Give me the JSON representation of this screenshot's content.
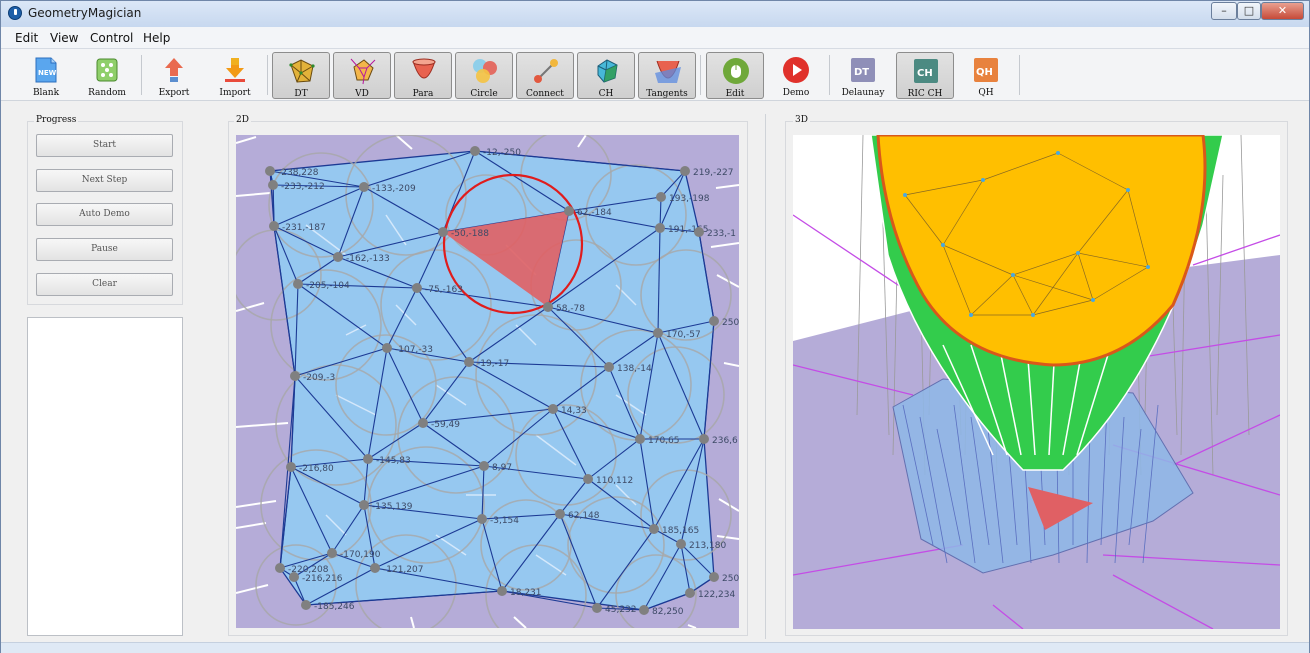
{
  "window": {
    "title": "GeometryMagician"
  },
  "window_controls": {
    "minimize": "–",
    "maximize": "□",
    "close": "✕"
  },
  "menu": [
    "Edit",
    "View",
    "Control",
    "Help"
  ],
  "toolbar": [
    {
      "label": "Blank",
      "icon": "new-file-icon",
      "active": false
    },
    {
      "label": "Random",
      "icon": "dice-icon",
      "active": false
    },
    {
      "label": "Export",
      "icon": "export-arrow-icon",
      "active": false
    },
    {
      "label": "Import",
      "icon": "import-arrow-icon",
      "active": false
    },
    {
      "label": "DT",
      "icon": "delaunay-icon",
      "active": true
    },
    {
      "label": "VD",
      "icon": "voronoi-icon",
      "active": true
    },
    {
      "label": "Para",
      "icon": "paraboloid-icon",
      "active": true
    },
    {
      "label": "Circle",
      "icon": "circles-icon",
      "active": true
    },
    {
      "label": "Connect",
      "icon": "connect-icon",
      "active": true
    },
    {
      "label": "CH",
      "icon": "convex-hull-icon",
      "active": true
    },
    {
      "label": "Tangents",
      "icon": "tangents-icon",
      "active": true
    },
    {
      "label": "Edit",
      "icon": "mouse-edit-icon",
      "active": true
    },
    {
      "label": "Demo",
      "icon": "play-icon",
      "active": false
    },
    {
      "label": "Delaunay",
      "icon": "dt-badge-icon",
      "active": false
    },
    {
      "label": "RIC CH",
      "icon": "ch-badge-icon",
      "active": true
    },
    {
      "label": "QH",
      "icon": "qh-badge-icon",
      "active": false
    }
  ],
  "progress": {
    "title": "Progress",
    "buttons": [
      "Start",
      "Next Step",
      "Auto Demo",
      "Pause",
      "Clear"
    ]
  },
  "view2d": {
    "title": "2D",
    "point_labels": [
      "-238,228",
      "-233,-212",
      "-133,-209",
      "-12,-250",
      "219,-227",
      "193,-198",
      "62,-184",
      "-231,-187",
      "-162,-133",
      "-50,-188",
      "191,-165",
      "233,-1",
      "-205,-104",
      "-75,-163",
      "58,-78",
      "250",
      "170,-57",
      "-107,-33",
      "-19,-17",
      "138,-14",
      "-209,-3",
      "14,33",
      "-59,49",
      "170,65",
      "236,6",
      "-216,80",
      "-145,83",
      "8,97",
      "110,112",
      "-135,139",
      "-3,154",
      "62,148",
      "185,165",
      "213,180",
      "-170,190",
      "-121,207",
      "-220,208",
      "-216,216",
      "18,231",
      "250",
      "-185,246",
      "45,232",
      "122,234",
      "82,250"
    ]
  },
  "view3d": {
    "title": "3D"
  },
  "colors": {
    "voronoi_bg": "#b5acd8",
    "hull_fill": "#96c8f0",
    "dt_edge": "#1c3a94",
    "circle": "#a8a8a8",
    "highlight_tri": "#e06064",
    "highlight_circle": "#e01c1c",
    "paraboloid_top": "#ffbf00",
    "paraboloid_side": "#33cc4c"
  }
}
